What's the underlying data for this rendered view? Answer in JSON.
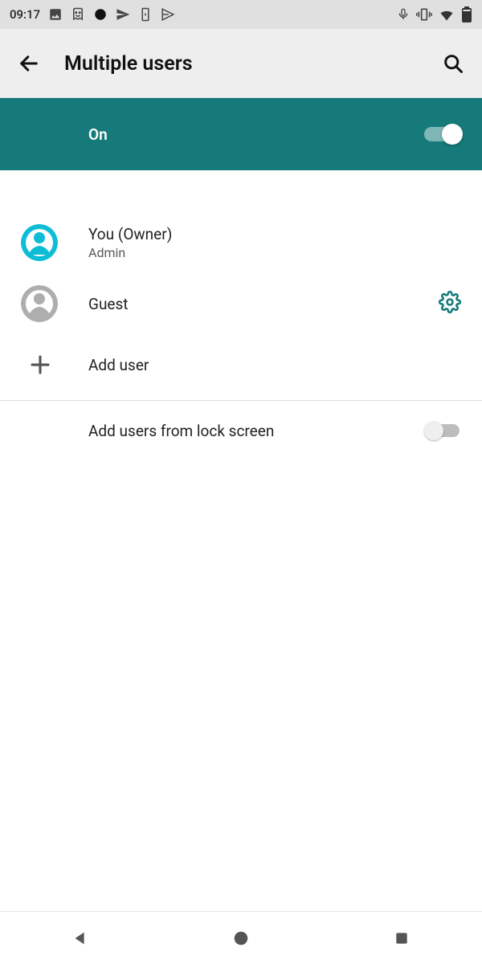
{
  "status": {
    "time": "09:17",
    "icons_left": [
      "image-icon",
      "smile-icon",
      "dot-icon",
      "send-icon",
      "device-icon",
      "play-icon"
    ],
    "icons_right": [
      "mic-icon",
      "vibrate-icon",
      "wifi-icon",
      "battery-icon"
    ]
  },
  "header": {
    "title": "Multiple users"
  },
  "banner": {
    "state_label": "On",
    "enabled": true
  },
  "users": [
    {
      "title": "You (Owner)",
      "subtitle": "Admin",
      "type": "owner",
      "has_settings": false
    },
    {
      "title": "Guest",
      "subtitle": "",
      "type": "guest",
      "has_settings": true
    }
  ],
  "add_user": {
    "label": "Add user"
  },
  "lock_screen": {
    "label": "Add users from lock screen",
    "enabled": false
  },
  "colors": {
    "accent": "#167a7a",
    "owner_avatar": "#0dbdd6"
  }
}
